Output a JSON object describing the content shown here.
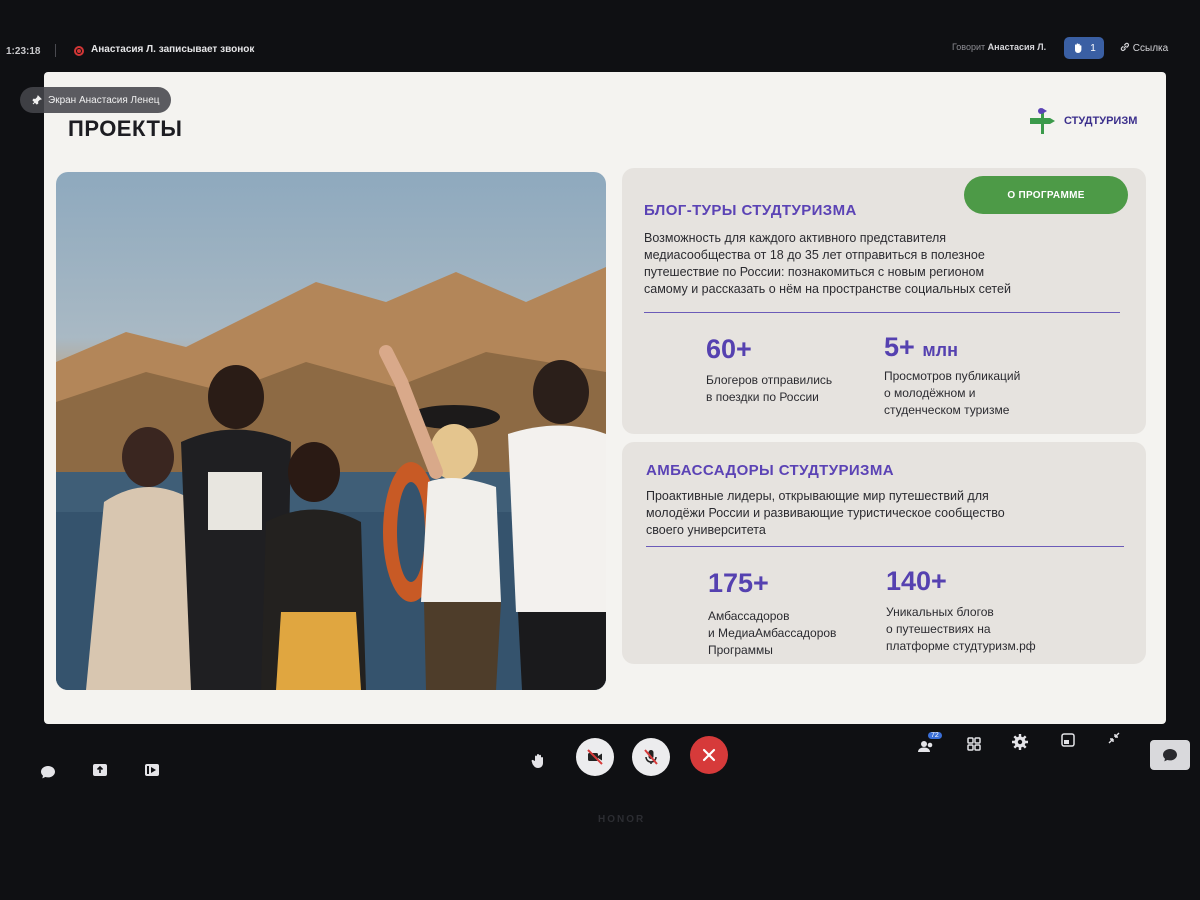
{
  "topbar": {
    "timer": "1:23:18",
    "recording_text": "Анастасия Л. записывает звонок",
    "speaker_prefix": "Говорит",
    "speaker_name": "Анастасия Л.",
    "hand_count": "1",
    "link_label": "Ссылка"
  },
  "screen_share": {
    "label": "Экран Анастасия Ленец"
  },
  "slide": {
    "title": "ПРОЕКТЫ",
    "logo_text": "СТУДТУРИЗМ",
    "program_button": "О ПРОГРАММЕ",
    "blog_tours": {
      "heading": "БЛОГ-ТУРЫ СТУДТУРИЗМА",
      "description_lines": [
        "Возможность для каждого активного представителя",
        "медиасообщества от 18 до 35 лет отправиться в полезное",
        "путешествие по России: познакомиться с новым регионом",
        "самому и рассказать о нём на пространстве социальных сетей"
      ],
      "stat1_value": "60+",
      "stat1_caption": [
        "Блогеров отправились",
        "в поездки по России"
      ],
      "stat2_value": "5+",
      "stat2_unit": "млн",
      "stat2_caption": [
        "Просмотров публикаций",
        "о молодёжном и",
        "студенческом туризме"
      ]
    },
    "ambassadors": {
      "heading": "АМБАССАДОРЫ СТУДТУРИЗМА",
      "description_lines": [
        "Проактивные лидеры, открывающие мир путешествий для",
        "молодёжи России и развивающие туристическое сообщество",
        "своего университета"
      ],
      "stat1_value": "175+",
      "stat1_caption": [
        "Амбассадоров",
        "и МедиаАмбассадоров",
        "Программы"
      ],
      "stat2_value": "140+",
      "stat2_caption": [
        "Уникальных блогов",
        "о путешествиях на",
        "платформе студтуризм.рф"
      ]
    }
  },
  "bottombar": {
    "participants_badge": "72"
  },
  "device": {
    "brand": "HONOR"
  },
  "icons": [
    "pin-icon",
    "hand-icon",
    "link-icon",
    "chat-icon",
    "share-screen-icon",
    "present-icon",
    "raise-hand-icon",
    "camera-off-icon",
    "mic-off-icon",
    "end-call-icon",
    "participants-icon",
    "grid-icon",
    "gear-icon",
    "layout-icon",
    "collapse-icon",
    "message-icon"
  ],
  "colors": {
    "accent_purple": "#5b43b5",
    "program_green": "#4d9a47",
    "end_call_red": "#d63a3a",
    "hand_badge_blue": "#3a5fa3"
  }
}
